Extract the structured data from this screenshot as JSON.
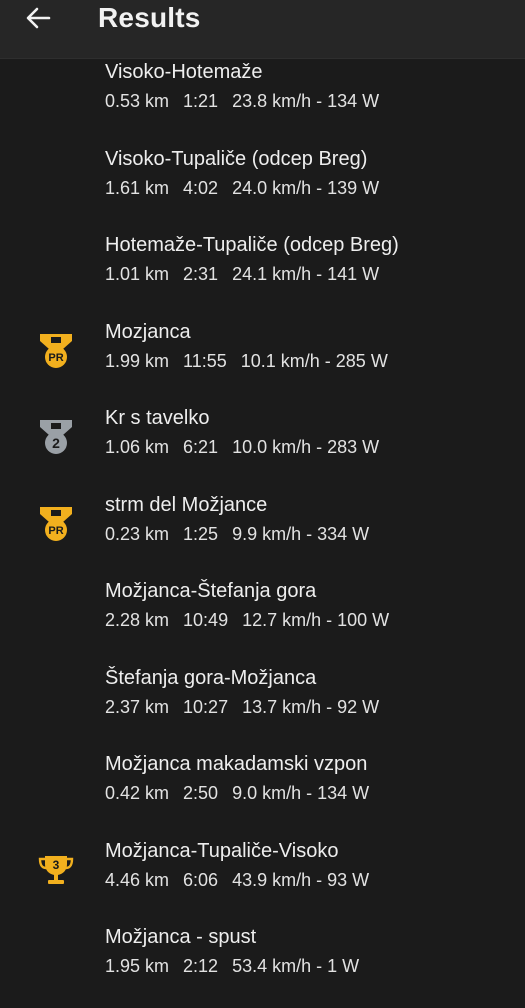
{
  "header": {
    "title": "Results",
    "back_icon": "arrow-left-icon"
  },
  "colors": {
    "background": "#1b1b1b",
    "header": "#262626",
    "text": "#eeeeee",
    "gold": "#f2b01e",
    "silver": "#9aa0a6"
  },
  "segments": [
    {
      "name": "Visoko-Hotemaže",
      "distance": "0.53 km",
      "time": "1:21",
      "speed_power": "23.8 km/h - 134 W",
      "badge": ""
    },
    {
      "name": "Visoko-Tupaliče (odcep Breg)",
      "distance": "1.61 km",
      "time": "4:02",
      "speed_power": "24.0 km/h - 139 W",
      "badge": ""
    },
    {
      "name": "Hotemaže-Tupaliče (odcep Breg)",
      "distance": "1.01 km",
      "time": "2:31",
      "speed_power": "24.1 km/h - 141 W",
      "badge": ""
    },
    {
      "name": "Mozjanca",
      "distance": "1.99 km",
      "time": "11:55",
      "speed_power": "10.1 km/h - 285 W",
      "badge": "pr",
      "badge_text": "PR"
    },
    {
      "name": "Kr s tavelko",
      "distance": "1.06 km",
      "time": "6:21",
      "speed_power": "10.0 km/h - 283 W",
      "badge": "medal-2",
      "badge_text": "2"
    },
    {
      "name": "strm del Možjance",
      "distance": "0.23 km",
      "time": "1:25",
      "speed_power": "9.9 km/h - 334 W",
      "badge": "pr",
      "badge_text": "PR"
    },
    {
      "name": "Možjanca-Štefanja gora",
      "distance": "2.28 km",
      "time": "10:49",
      "speed_power": "12.7 km/h - 100 W",
      "badge": ""
    },
    {
      "name": "Štefanja gora-Možjanca",
      "distance": "2.37 km",
      "time": "10:27",
      "speed_power": "13.7 km/h - 92 W",
      "badge": ""
    },
    {
      "name": "Možjanca makadamski vzpon",
      "distance": "0.42 km",
      "time": "2:50",
      "speed_power": "9.0 km/h - 134 W",
      "badge": ""
    },
    {
      "name": "Možjanca-Tupaliče-Visoko",
      "distance": "4.46 km",
      "time": "6:06",
      "speed_power": "43.9 km/h - 93 W",
      "badge": "trophy-3",
      "badge_text": "3"
    },
    {
      "name": "Možjanca - spust",
      "distance": "1.95 km",
      "time": "2:12",
      "speed_power": "53.4 km/h - 1 W",
      "badge": ""
    }
  ]
}
